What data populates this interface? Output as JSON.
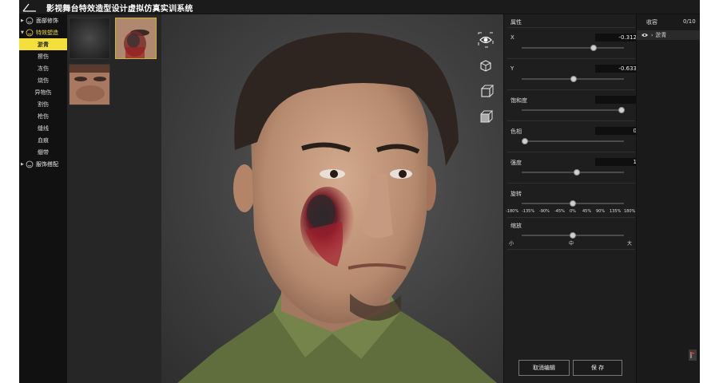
{
  "app": {
    "title": "影视舞台特效造型设计虚拟仿真实训系统"
  },
  "menu": {
    "categories": [
      {
        "label": "面部修饰"
      },
      {
        "label": "特效塑造",
        "subitems": [
          "淤青",
          "擦伤",
          "冻伤",
          "烧伤",
          "异物伤",
          "割伤",
          "枪伤",
          "缝线",
          "血痕",
          "绷带"
        ]
      },
      {
        "label": "服饰搭配"
      }
    ],
    "active_subitem": "淤青"
  },
  "thumbnails": [
    {
      "name": "blank"
    },
    {
      "name": "bruise-face",
      "selected": true
    },
    {
      "name": "eye-closeup"
    }
  ],
  "viewport": {
    "tools": [
      "eye-icon",
      "cube-front-icon",
      "cube-side-icon",
      "cube-persp-icon"
    ]
  },
  "properties": {
    "title": "属性",
    "x": {
      "label": "X",
      "value": "-0.312",
      "fraction": 0.7
    },
    "y": {
      "label": "Y",
      "value": "-0.633",
      "fraction": 0.51
    },
    "saturation": {
      "label": "饱和度",
      "value": "",
      "fraction": 0.98
    },
    "hue": {
      "label": "色相",
      "value": "0",
      "fraction": 0.03
    },
    "intensity": {
      "label": "强度",
      "value": "1",
      "fraction": 0.54
    },
    "rotation": {
      "label": "旋转",
      "ticks": [
        "-180%",
        "-135%",
        "-90%",
        "-45%",
        "0%",
        "45%",
        "90%",
        "135%",
        "180%"
      ],
      "fraction": 0.5
    },
    "scale": {
      "label": "缩放",
      "small": "小",
      "mid": "中",
      "large": "大",
      "fraction": 0.5
    }
  },
  "buttons": {
    "cancel": "取消编辑",
    "save": "保 存"
  },
  "inventory": {
    "title": "收容",
    "count": "0/10",
    "items": [
      "淤青"
    ]
  }
}
